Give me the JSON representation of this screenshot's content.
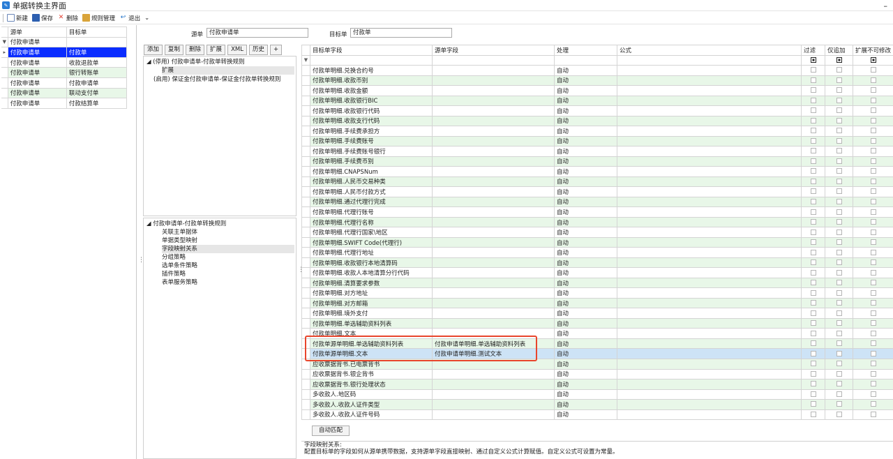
{
  "window": {
    "title": "单据转换主界面",
    "minimize": "–"
  },
  "toolbar": {
    "new": "新建",
    "save": "保存",
    "delete": "删除",
    "rules": "规则管理",
    "exit": "退出",
    "more": "⌄"
  },
  "left": {
    "headers": [
      "源单",
      "目标单"
    ],
    "filter_row": [
      "付款申请单",
      ""
    ],
    "rows": [
      [
        "付款申请单",
        "付款单"
      ],
      [
        "付款申请单",
        "收款退款单"
      ],
      [
        "付款申请单",
        "银行转账单"
      ],
      [
        "付款申请单",
        "付款申请单"
      ],
      [
        "付款申请单",
        "联动支付单"
      ],
      [
        "付款申请单",
        "付款结算单"
      ]
    ]
  },
  "source_bar": {
    "src_label": "源单",
    "src_value": "付款申请单",
    "tgt_label": "目标单",
    "tgt_value": "付款单"
  },
  "buttons": [
    "添加",
    "复制",
    "删除",
    "扩展",
    "XML",
    "历史",
    "+"
  ],
  "tree1": [
    "◢ (停用) 付款申请单-付款单转换规则",
    "扩展",
    "(启用) 保证金付款申请单-保证金付款单转换规则"
  ],
  "tree2": [
    "◢ 付款申请单-付款单转换规则",
    "关联主单据体",
    "单据类型映射",
    "字段映射关系",
    "分组策略",
    "选单条件策略",
    "插件策略",
    "表单服务策略"
  ],
  "grid": {
    "headers": [
      "目标单字段",
      "源单字段",
      "处理",
      "公式",
      "过滤",
      "仅追加",
      "扩展不可修改"
    ],
    "rows": [
      [
        "付款单明细.兑换合约号",
        "",
        "自动"
      ],
      [
        "付款单明细.收款币别",
        "",
        "自动"
      ],
      [
        "付款单明细.收款金额",
        "",
        "自动"
      ],
      [
        "付款单明细.收款银行BIC",
        "",
        "自动"
      ],
      [
        "付款单明细.收款银行代码",
        "",
        "自动"
      ],
      [
        "付款单明细.收款支行代码",
        "",
        "自动"
      ],
      [
        "付款单明细.手续费承担方",
        "",
        "自动"
      ],
      [
        "付款单明细.手续费账号",
        "",
        "自动"
      ],
      [
        "付款单明细.手续费账号银行",
        "",
        "自动"
      ],
      [
        "付款单明细.手续费币别",
        "",
        "自动"
      ],
      [
        "付款单明细.CNAPSNum",
        "",
        "自动"
      ],
      [
        "付款单明细.人民币交易种类",
        "",
        "自动"
      ],
      [
        "付款单明细.人民币付款方式",
        "",
        "自动"
      ],
      [
        "付款单明细.通过代理行完成",
        "",
        "自动"
      ],
      [
        "付款单明细.代理行账号",
        "",
        "自动"
      ],
      [
        "付款单明细.代理行名称",
        "",
        "自动"
      ],
      [
        "付款单明细.代理行国家\\地区",
        "",
        "自动"
      ],
      [
        "付款单明细.SWIFT Code(代理行)",
        "",
        "自动"
      ],
      [
        "付款单明细.代理行地址",
        "",
        "自动"
      ],
      [
        "付款单明细.收款银行本地清算码",
        "",
        "自动"
      ],
      [
        "付款单明细.收款人本地清算分行代码",
        "",
        "自动"
      ],
      [
        "付款单明细.清算要求参数",
        "",
        "自动"
      ],
      [
        "付款单明细.对方地址",
        "",
        "自动"
      ],
      [
        "付款单明细.对方邮箱",
        "",
        "自动"
      ],
      [
        "付款单明细.境外支付",
        "",
        "自动"
      ],
      [
        "付款单明细.单选辅助资料列表",
        "",
        "自动"
      ],
      [
        "付款单明细.文本",
        "",
        "自动"
      ],
      [
        "付款单源单明细.单选辅助资料列表",
        "付款申请单明细.单选辅助资料列表",
        "自动"
      ],
      [
        "付款单源单明细.文本",
        "付款申请单明细.测试文本",
        "自动"
      ],
      [
        "应收票据背书.已电票背书",
        "",
        "自动"
      ],
      [
        "应收票据背书.银企背书",
        "",
        "自动"
      ],
      [
        "应收票据背书.银行处理状态",
        "",
        "自动"
      ],
      [
        "多收款人.地区码",
        "",
        "自动"
      ],
      [
        "多收款人.收款人证件类型",
        "",
        "自动"
      ],
      [
        "多收款人.收款人证件号码",
        "",
        "自动"
      ]
    ]
  },
  "auto_match": "自动匹配",
  "description": {
    "title": "字段映射关系:",
    "line1": "配置目标单的字段如何从源单携带数据，支持源单字段直接映射、通过自定义公式计算赋值。自定义公式可设置为常量。"
  }
}
